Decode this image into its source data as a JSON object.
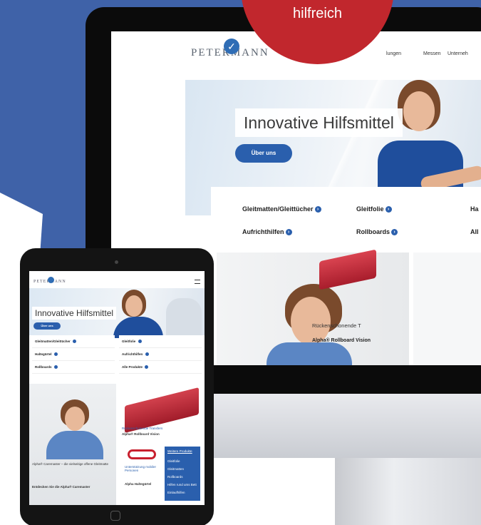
{
  "badge": {
    "text": "hilfreich"
  },
  "desktop": {
    "logo": "PETERMANN",
    "nav": [
      "lungen",
      "Messen",
      "Unterneh"
    ],
    "hero": {
      "title": "Innovative Hilfsmittel",
      "button": "Über uns"
    },
    "categories": [
      "Gleitmatten/Gleittücher",
      "Gleitfolie",
      "Ha",
      "Aufrichthilfen",
      "Rollboards",
      "All"
    ],
    "lower": {
      "caption": "Rückenschonende T",
      "product": "Alpha® Rollboard Vision"
    }
  },
  "tablet": {
    "logo": "PETERMANN",
    "hero": {
      "title": "Innovative Hilfsmittel",
      "button": "Über uns"
    },
    "categories": [
      "Gleitmatten/Gleittücher",
      "Gleitfolie",
      "Haltegürtel",
      "Aufrichthilfen",
      "Rollboards",
      "Alle Produkte"
    ],
    "lower": {
      "right_title": "Rückenschonende Transfers",
      "right_sub": "Alpha® Rollboard Vision",
      "left_title": "Alpha® Caremaster – die vielseitige offene Gleitmatte",
      "left_link": "Entdecken Sie die Alpha® Caremaster",
      "belt_title": "Unterstützung mobiler Personen",
      "belt_sub": "Alpha Haltegürtel",
      "box_title": "Weitere Produkte",
      "box_items": [
        "Gleitfolie",
        "Gleitmatten",
        "Rollboards",
        "Hilfen rund ums Bett",
        "Einlaufhilfen"
      ]
    }
  }
}
